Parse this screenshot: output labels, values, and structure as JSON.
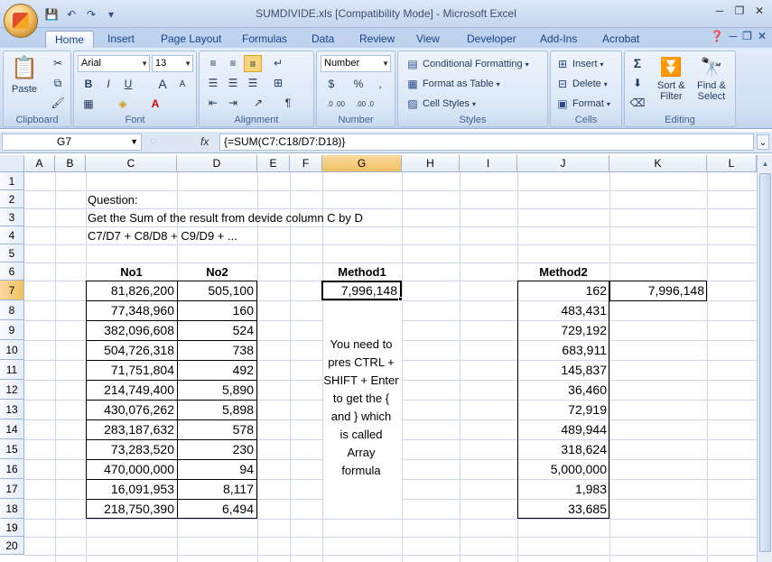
{
  "window": {
    "title": "SUMDIVIDE.xls  [Compatibility Mode] - Microsoft Excel"
  },
  "qat": {
    "save": "💾",
    "undo": "↶",
    "redo": "↷",
    "customize": "▾"
  },
  "tabs": [
    "Home",
    "Insert",
    "Page Layout",
    "Formulas",
    "Data",
    "Review",
    "View",
    "Developer",
    "Add-Ins",
    "Acrobat"
  ],
  "ribbon": {
    "clipboard": {
      "label": "Clipboard",
      "paste": "Paste"
    },
    "font": {
      "label": "Font",
      "name": "Arial",
      "size": "13",
      "bold": "B",
      "italic": "I",
      "underline": "U",
      "grow": "A",
      "shrink": "A"
    },
    "alignment": {
      "label": "Alignment"
    },
    "number": {
      "label": "Number",
      "format": "Number",
      "currency": "$",
      "percent": "%",
      "comma": ",",
      "inc_decimal": ".0 .00",
      "dec_decimal": ".00 .0"
    },
    "styles": {
      "label": "Styles",
      "conditional": "Conditional Formatting",
      "format_table": "Format as Table",
      "cell_styles": "Cell Styles"
    },
    "cells": {
      "label": "Cells",
      "insert": "Insert",
      "delete": "Delete",
      "format": "Format"
    },
    "editing": {
      "label": "Editing",
      "sort1": "Sort &",
      "sort2": "Filter",
      "find1": "Find &",
      "find2": "Select",
      "sigma": "Σ"
    }
  },
  "formula_bar": {
    "name_box": "G7",
    "fx": "fx",
    "formula": "{=SUM(C7:C18/D7:D18)}"
  },
  "columns": [
    "A",
    "B",
    "C",
    "D",
    "E",
    "F",
    "G",
    "H",
    "I",
    "J",
    "K",
    "L"
  ],
  "rows": [
    "1",
    "2",
    "3",
    "4",
    "5",
    "6",
    "7",
    "8",
    "9",
    "10",
    "11",
    "12",
    "13",
    "14",
    "15",
    "16",
    "17",
    "18",
    "19",
    "20"
  ],
  "sheet": {
    "question_label": "Question:",
    "question_line1": "Get the Sum of the result from devide column C by D",
    "question_line2": "C7/D7 + C8/D8 + C9/D9 + ...",
    "header_no1": "No1",
    "header_no2": "No2",
    "header_method1": "Method1",
    "header_method2": "Method2",
    "no1": [
      "81,826,200",
      "77,348,960",
      "382,096,608",
      "504,726,318",
      "71,751,804",
      "214,749,400",
      "430,076,262",
      "283,187,632",
      "73,283,520",
      "470,000,000",
      "16,091,953",
      "218,750,390"
    ],
    "no2": [
      "505,100",
      "160",
      "524",
      "738",
      "492",
      "5,890",
      "5,898",
      "578",
      "230",
      "94",
      "8,117",
      "6,494"
    ],
    "method1_result": "7,996,148",
    "method2": [
      "162",
      "483,431",
      "729,192",
      "683,911",
      "145,837",
      "36,460",
      "72,919",
      "489,944",
      "318,624",
      "5,000,000",
      "1,983",
      "33,685"
    ],
    "method2_sum": "7,996,148",
    "note_lines": [
      "You need to",
      "pres CTRL +",
      "SHIFT + Enter",
      "to get the {",
      "and } which",
      "is called",
      "Array",
      "formula"
    ]
  }
}
